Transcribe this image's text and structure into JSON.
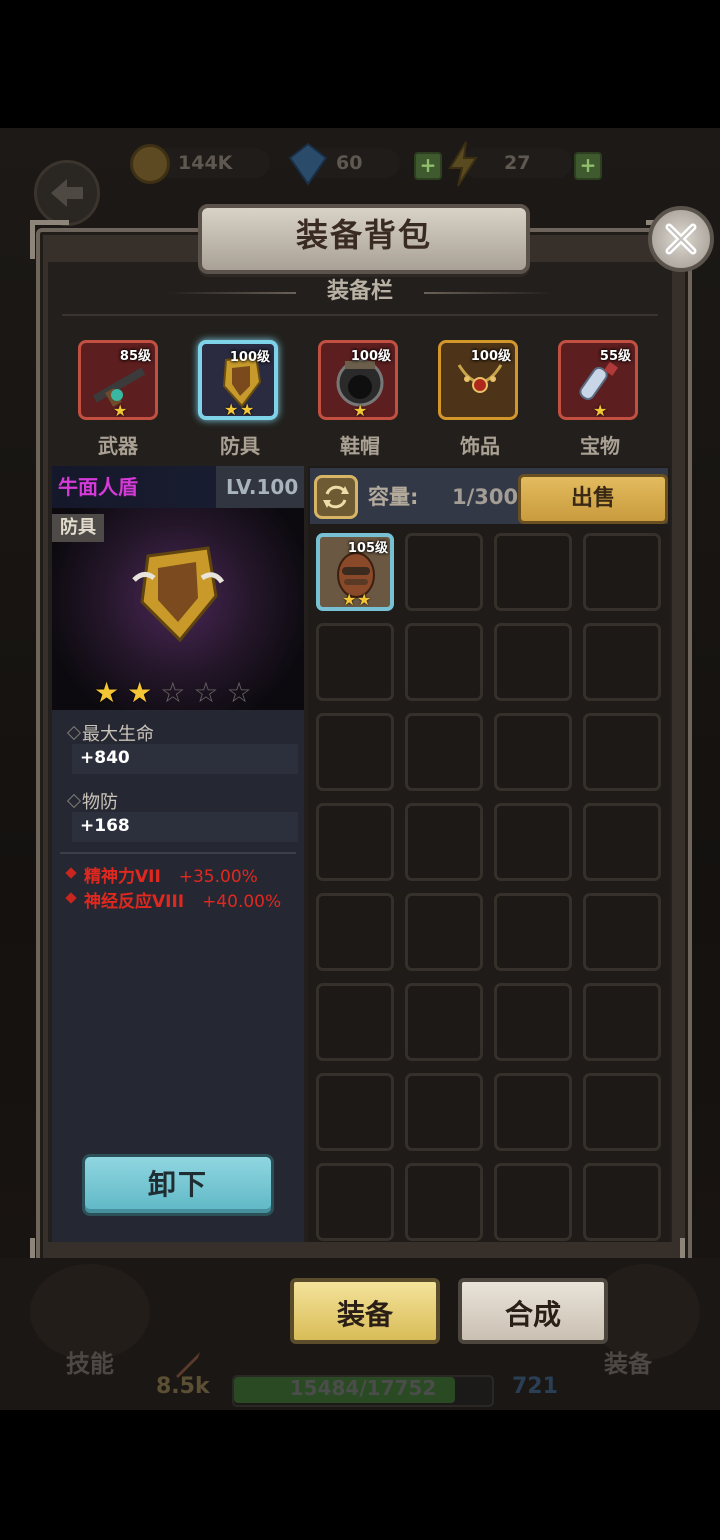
{
  "resources": {
    "gold": "144K",
    "gems": "60",
    "energy": "27"
  },
  "window": {
    "title": "装备背包",
    "section_title": "装备栏"
  },
  "categories": [
    {
      "label": "武器",
      "level": "85级",
      "stars": 1,
      "frame": "#c25040",
      "bg": "#5c1e1e"
    },
    {
      "label": "防具",
      "level": "100级",
      "stars": 2,
      "frame": "#7fd3e8",
      "bg": "#2a2a40"
    },
    {
      "label": "鞋帽",
      "level": "100级",
      "stars": 1,
      "frame": "#c25040",
      "bg": "#5c1e1e"
    },
    {
      "label": "饰品",
      "level": "100级",
      "stars": 0,
      "frame": "#d3962a",
      "bg": "#4d3318"
    },
    {
      "label": "宝物",
      "level": "55级",
      "stars": 1,
      "frame": "#c25040",
      "bg": "#5c1e1e"
    }
  ],
  "selected_item": {
    "name": "牛面人盾",
    "level": "LV.100",
    "type": "防具",
    "stars": 2,
    "max_stars": 5,
    "stats": [
      {
        "name": "最大生命",
        "value": "+840"
      },
      {
        "name": "物防",
        "value": "+168"
      }
    ],
    "special_attrs": [
      {
        "name": "精神力VII",
        "value": "+35.00%"
      },
      {
        "name": "神经反应VIII",
        "value": "+40.00%"
      }
    ],
    "unequip_label": "卸下"
  },
  "inventory": {
    "capacity_label": "容量:",
    "capacity_value": "1/300",
    "sell_label": "出售",
    "items": [
      {
        "level": "105级",
        "stars": 2
      }
    ]
  },
  "bottom": {
    "equip_label": "装备",
    "synth_label": "合成",
    "skills_label": "技能",
    "gear_label": "装备",
    "power": "8.5k",
    "hp": "15484/17752",
    "hp_fraction": 0.872,
    "defense": "721"
  },
  "colors": {
    "accent_gold": "#e3bb5e",
    "item_name_purple": "#d63ad8",
    "attr_red": "#e0281f",
    "star": "#f4c534"
  },
  "icons": [
    "back-arrow-icon",
    "gold-coin-icon",
    "gem-icon",
    "lightning-icon",
    "close-icon",
    "refresh-icon",
    "rifle-icon",
    "shield-icon",
    "helmet-icon",
    "necklace-icon",
    "potion-icon",
    "brown-shield-icon",
    "sword-icon"
  ]
}
